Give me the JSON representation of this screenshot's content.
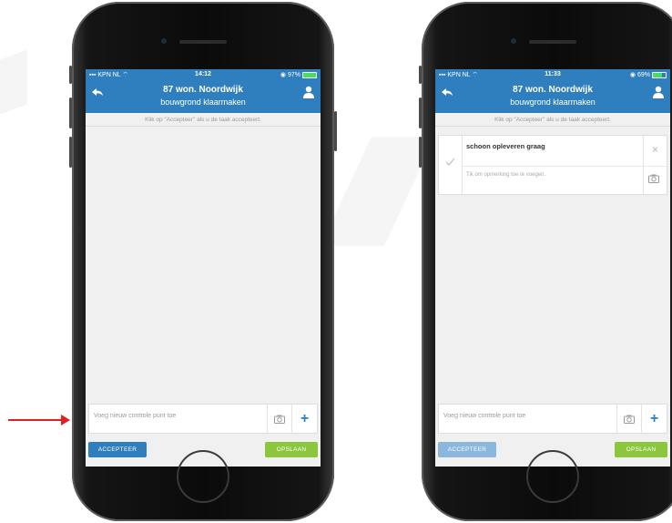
{
  "screens": [
    {
      "status": {
        "carrier": "KPN NL",
        "time": "14:12",
        "battery_text": "97%",
        "battery_level": 0.97
      },
      "title": "87 won. Noordwijk",
      "subtitle": "bouwgrond klaarmaken",
      "hint": "Klik op \"Accepteer\" als u de taak accepteert.",
      "add_placeholder": "Voeg nieuw controle punt toe",
      "add_plus": "+",
      "accept_label": "ACCEPTEER",
      "save_label": "OPSLAAN"
    },
    {
      "status": {
        "carrier": "KPN NL",
        "time": "11:33",
        "battery_text": "69%",
        "battery_level": 0.69
      },
      "title": "87 won. Noordwijk",
      "subtitle": "bouwgrond klaarmaken",
      "hint": "Klik op \"Accepteer\" als u de taak accepteert.",
      "checkpoint": {
        "title": "schoon opleveren graag",
        "note_placeholder": "Tik om opmerking toe te voegen.",
        "close": "×"
      },
      "add_placeholder": "Voeg nieuw controle punt toe",
      "add_plus": "+",
      "accept_label": "ACCEPTEER",
      "save_label": "OPSLAAN"
    }
  ],
  "colors": {
    "header": "#2f7fbe",
    "save": "#8cc63f",
    "accept_disabled": "#8bb7dd",
    "arrow": "#e02020"
  },
  "icons": [
    "back-arrow-icon",
    "user-icon",
    "camera-icon",
    "plus-icon",
    "check-icon",
    "close-icon",
    "signal-icon",
    "wifi-icon",
    "alarm-icon",
    "battery-icon"
  ]
}
